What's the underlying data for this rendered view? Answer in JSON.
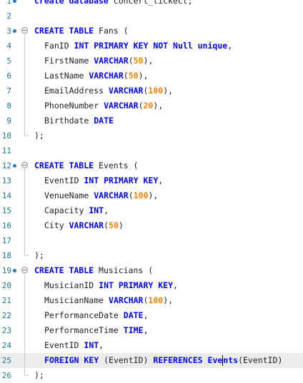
{
  "editor": {
    "lines": [
      {
        "n": "1",
        "marker": true,
        "fold": false,
        "indent": false,
        "tokens": [
          [
            "kw",
            "create database "
          ],
          [
            "txt",
            "concert_tickect;"
          ]
        ]
      },
      {
        "n": "2",
        "marker": false,
        "fold": false,
        "indent": false,
        "tokens": []
      },
      {
        "n": "3",
        "marker": true,
        "fold": true,
        "indent": false,
        "tokens": [
          [
            "kw",
            "CREATE TABLE "
          ],
          [
            "txt",
            "Fans ("
          ]
        ]
      },
      {
        "n": "4",
        "marker": false,
        "fold": false,
        "indent": true,
        "tokens": [
          [
            "txt",
            "FanID "
          ],
          [
            "kw",
            "INT PRIMARY KEY NOT Null unique"
          ],
          [
            "txt",
            ","
          ]
        ]
      },
      {
        "n": "5",
        "marker": false,
        "fold": false,
        "indent": true,
        "tokens": [
          [
            "txt",
            "FirstName "
          ],
          [
            "kw",
            "VARCHAR"
          ],
          [
            "txt",
            "("
          ],
          [
            "num",
            "50"
          ],
          [
            "txt",
            "),"
          ]
        ]
      },
      {
        "n": "6",
        "marker": false,
        "fold": false,
        "indent": true,
        "tokens": [
          [
            "txt",
            "LastName "
          ],
          [
            "kw",
            "VARCHAR"
          ],
          [
            "txt",
            "("
          ],
          [
            "num",
            "50"
          ],
          [
            "txt",
            "),"
          ]
        ]
      },
      {
        "n": "7",
        "marker": false,
        "fold": false,
        "indent": true,
        "tokens": [
          [
            "txt",
            "EmailAddress "
          ],
          [
            "kw",
            "VARCHAR"
          ],
          [
            "txt",
            "("
          ],
          [
            "num",
            "100"
          ],
          [
            "txt",
            "),"
          ]
        ]
      },
      {
        "n": "8",
        "marker": false,
        "fold": false,
        "indent": true,
        "tokens": [
          [
            "txt",
            "PhoneNumber "
          ],
          [
            "kw",
            "VARCHAR"
          ],
          [
            "txt",
            "("
          ],
          [
            "num",
            "20"
          ],
          [
            "txt",
            "),"
          ]
        ]
      },
      {
        "n": "9",
        "marker": false,
        "fold": false,
        "indent": true,
        "tokens": [
          [
            "txt",
            "Birthdate "
          ],
          [
            "kw",
            "DATE"
          ]
        ]
      },
      {
        "n": "10",
        "marker": false,
        "fold": false,
        "indent": false,
        "tokens": [
          [
            "txt",
            ");"
          ]
        ]
      },
      {
        "n": "11",
        "marker": false,
        "fold": false,
        "indent": false,
        "tokens": []
      },
      {
        "n": "12",
        "marker": true,
        "fold": true,
        "indent": false,
        "tokens": [
          [
            "kw",
            "CREATE TABLE "
          ],
          [
            "txt",
            "Events ("
          ]
        ]
      },
      {
        "n": "13",
        "marker": false,
        "fold": false,
        "indent": true,
        "tokens": [
          [
            "txt",
            "EventID "
          ],
          [
            "kw",
            "INT PRIMARY KEY"
          ],
          [
            "txt",
            ","
          ]
        ]
      },
      {
        "n": "14",
        "marker": false,
        "fold": false,
        "indent": true,
        "tokens": [
          [
            "txt",
            "VenueName "
          ],
          [
            "kw",
            "VARCHAR"
          ],
          [
            "txt",
            "("
          ],
          [
            "num",
            "100"
          ],
          [
            "txt",
            "),"
          ]
        ]
      },
      {
        "n": "15",
        "marker": false,
        "fold": false,
        "indent": true,
        "tokens": [
          [
            "txt",
            "Capacity "
          ],
          [
            "kw",
            "INT"
          ],
          [
            "txt",
            ","
          ]
        ]
      },
      {
        "n": "16",
        "marker": false,
        "fold": false,
        "indent": true,
        "tokens": [
          [
            "txt",
            "City "
          ],
          [
            "kw",
            "VARCHAR"
          ],
          [
            "txt",
            "("
          ],
          [
            "num",
            "50"
          ],
          [
            "txt",
            ")"
          ]
        ]
      },
      {
        "n": "17",
        "marker": false,
        "fold": false,
        "indent": false,
        "tokens": []
      },
      {
        "n": "18",
        "marker": false,
        "fold": false,
        "indent": false,
        "tokens": [
          [
            "txt",
            ");"
          ]
        ]
      },
      {
        "n": "19",
        "marker": true,
        "fold": true,
        "indent": false,
        "tokens": [
          [
            "kw",
            "CREATE TABLE "
          ],
          [
            "txt",
            "Musicians ("
          ]
        ]
      },
      {
        "n": "20",
        "marker": false,
        "fold": false,
        "indent": true,
        "tokens": [
          [
            "txt",
            "MusicianID "
          ],
          [
            "kw",
            "INT PRIMARY KEY"
          ],
          [
            "txt",
            ","
          ]
        ]
      },
      {
        "n": "21",
        "marker": false,
        "fold": false,
        "indent": true,
        "tokens": [
          [
            "txt",
            "MusicianName "
          ],
          [
            "kw",
            "VARCHAR"
          ],
          [
            "txt",
            "("
          ],
          [
            "num",
            "100"
          ],
          [
            "txt",
            "),"
          ]
        ]
      },
      {
        "n": "22",
        "marker": false,
        "fold": false,
        "indent": true,
        "tokens": [
          [
            "txt",
            "PerformanceDate "
          ],
          [
            "kw",
            "DATE"
          ],
          [
            "txt",
            ","
          ]
        ]
      },
      {
        "n": "23",
        "marker": false,
        "fold": false,
        "indent": true,
        "tokens": [
          [
            "txt",
            "PerformanceTime "
          ],
          [
            "kw",
            "TIME"
          ],
          [
            "txt",
            ","
          ]
        ]
      },
      {
        "n": "24",
        "marker": false,
        "fold": false,
        "indent": true,
        "tokens": [
          [
            "txt",
            "EventID "
          ],
          [
            "kw",
            "INT"
          ],
          [
            "txt",
            ","
          ]
        ]
      },
      {
        "n": "25",
        "marker": false,
        "fold": false,
        "indent": true,
        "current": true,
        "tokens": [
          [
            "kw",
            "FOREIGN KEY "
          ],
          [
            "txt",
            "(EventID) "
          ],
          [
            "kw",
            "REFERENCES "
          ],
          [
            "kw",
            "Eve"
          ],
          [
            "cursor",
            ""
          ],
          [
            "kw",
            "nts"
          ],
          [
            "txt",
            "(EventID)"
          ]
        ]
      },
      {
        "n": "26",
        "marker": false,
        "fold": false,
        "indent": false,
        "tokens": [
          [
            "txt",
            ");"
          ]
        ]
      }
    ]
  }
}
